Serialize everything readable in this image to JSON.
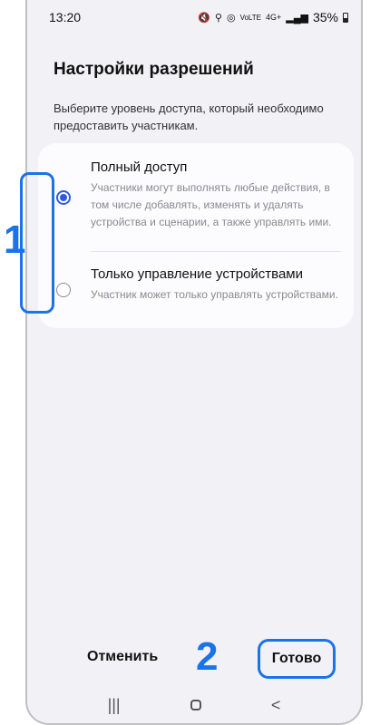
{
  "status_bar": {
    "time": "13:20",
    "icons": [
      "mute-icon",
      "location-icon",
      "hotspot-icon",
      "volte-icon",
      "signal-icon"
    ],
    "network": "4G+",
    "volte": "VoLTE",
    "battery": "35%"
  },
  "page": {
    "title": "Настройки разрешений",
    "subtitle": "Выберите уровень доступа, который необходимо предоставить участникам."
  },
  "options": [
    {
      "title": "Полный доступ",
      "description": "Участники могут выполнять любые действия, в том числе добавлять, изменять и удалять устройства и сценарии, а также управлять ими.",
      "selected": true
    },
    {
      "title": "Только управление устройствами",
      "description": "Участник может только управлять устройствами.",
      "selected": false
    }
  ],
  "annotations": {
    "marker_1": "1",
    "marker_2": "2",
    "highlight_color": "#1a73e8"
  },
  "footer": {
    "cancel_label": "Отменить",
    "done_label": "Готово"
  },
  "nav": {
    "recents": "|||",
    "home": "home-icon",
    "back": "<"
  }
}
